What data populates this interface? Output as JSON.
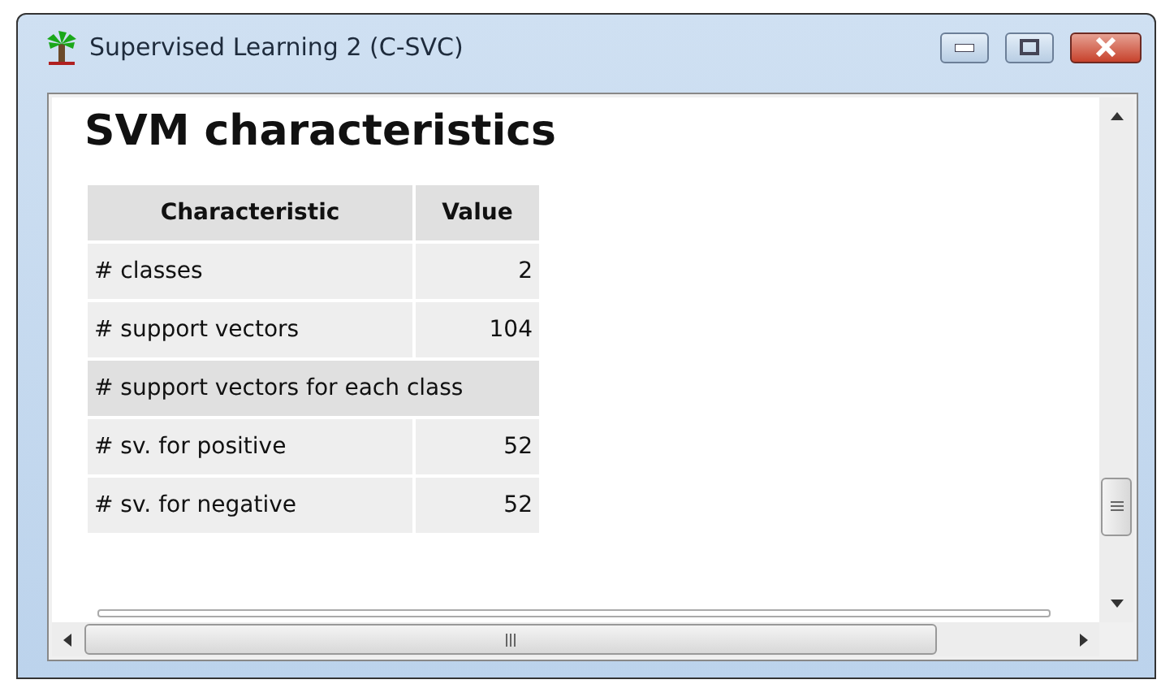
{
  "window": {
    "title": "Supervised Learning 2 (C-SVC)"
  },
  "heading": "SVM characteristics",
  "table": {
    "columns": [
      "Characteristic",
      "Value"
    ],
    "rows": [
      {
        "kind": "pair",
        "cells": [
          "# classes",
          "2"
        ]
      },
      {
        "kind": "pair",
        "cells": [
          "# support vectors",
          "104"
        ]
      },
      {
        "kind": "span",
        "cells": [
          "# support vectors for each class"
        ]
      },
      {
        "kind": "pair",
        "cells": [
          "# sv. for positive",
          "52"
        ]
      },
      {
        "kind": "pair",
        "cells": [
          "# sv. for negative",
          "52"
        ]
      }
    ]
  }
}
